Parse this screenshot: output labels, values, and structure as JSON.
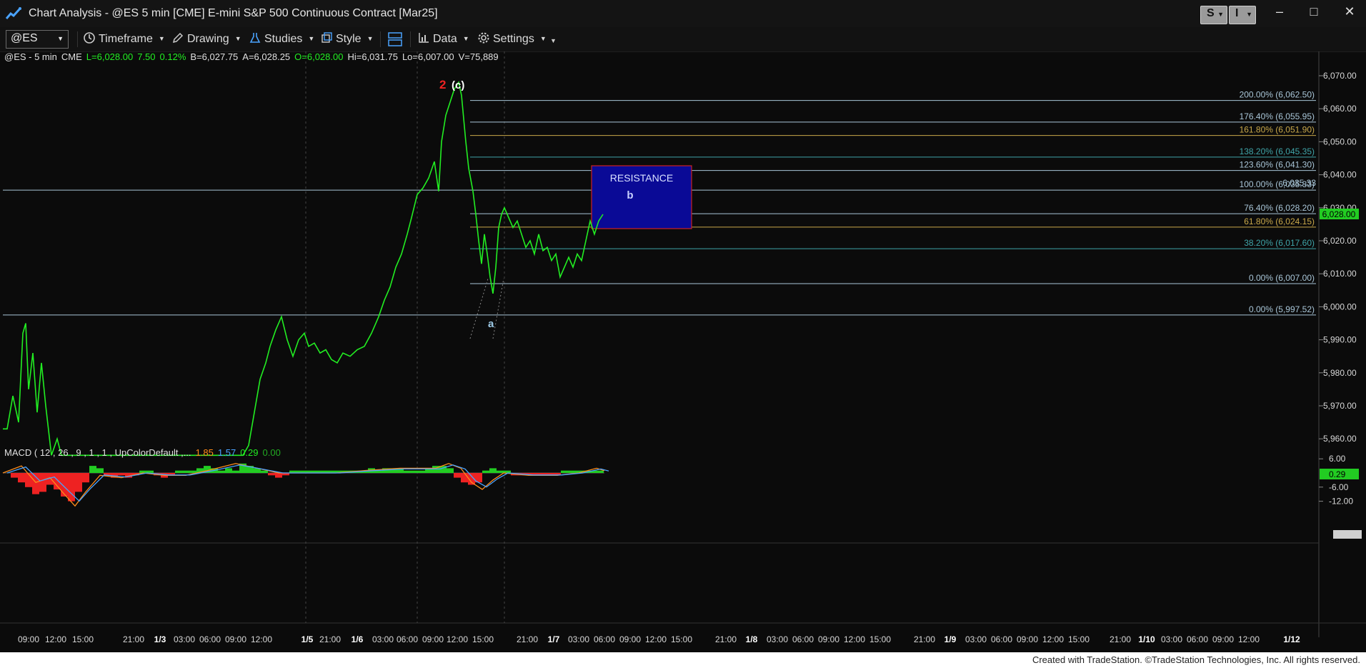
{
  "window": {
    "title": "Chart Analysis - @ES 5 min [CME] E-mini S&P 500 Continuous Contract [Mar25]",
    "buttons": [
      "S",
      "I"
    ],
    "controls": [
      "–",
      "□",
      "✕"
    ]
  },
  "toolbar": {
    "symbol": "@ES",
    "items": [
      {
        "label": "Timeframe",
        "icon": "clock-icon"
      },
      {
        "label": "Drawing",
        "icon": "pencil-icon"
      },
      {
        "label": "Studies",
        "icon": "flask-icon"
      },
      {
        "label": "Style",
        "icon": "style-icon"
      },
      {
        "label": "Data",
        "icon": "bar-chart-icon"
      },
      {
        "label": "Settings",
        "icon": "gear-icon"
      }
    ]
  },
  "status_line": {
    "symbol": "@ES - 5 min",
    "exchange": "CME",
    "last": "L=6,028.00",
    "change": "7.50",
    "pct": "0.12%",
    "bid": "B=6,027.75",
    "ask": "A=6,028.25",
    "open": "O=6,028.00",
    "high": "Hi=6,031.75",
    "low": "Lo=6,007.00",
    "volume": "V=75,889"
  },
  "macd_status": {
    "label": "MACD ( 12 , 26 , 9 , 1 , 1 , UpColorDefault ,...",
    "v1": "1.85",
    "v2": "1.57",
    "v3": "0.29",
    "v4": "0.00"
  },
  "price_axis": {
    "ticks": [
      "6,070.00",
      "6,060.00",
      "6,050.00",
      "6,040.00",
      "6,030.00",
      "6,020.00",
      "6,010.00",
      "6,000.00",
      "5,990.00",
      "5,980.00",
      "5,970.00",
      "5,960.00"
    ],
    "tick_values": [
      6070,
      6060,
      6050,
      6040,
      6030,
      6020,
      6010,
      6000,
      5990,
      5980,
      5970,
      5960
    ],
    "last_price": "6,028.00",
    "last_price_value": 6028
  },
  "macd_axis": {
    "ticks": [
      "6.00",
      "-6.00",
      "-12.00"
    ],
    "tick_values": [
      6,
      -6,
      -12
    ],
    "current": "0.29",
    "current_value": 0.29
  },
  "time_axis": [
    "09:00",
    "12:00",
    "15:00",
    "21:00",
    "1/3",
    "03:00",
    "06:00",
    "09:00",
    "12:00",
    "1/5",
    "21:00",
    "1/6",
    "03:00",
    "06:00",
    "09:00",
    "12:00",
    "15:00",
    "21:00",
    "1/7",
    "03:00",
    "06:00",
    "09:00",
    "12:00",
    "15:00",
    "21:00",
    "1/8",
    "03:00",
    "06:00",
    "09:00",
    "12:00",
    "15:00",
    "21:00",
    "1/9",
    "03:00",
    "06:00",
    "09:00",
    "12:00",
    "15:00",
    "21:00",
    "1/10",
    "03:00",
    "06:00",
    "09:00",
    "12:00",
    "1/12"
  ],
  "annotations": {
    "wave_2": "2",
    "wave_c": "(c)",
    "wave_a": "a",
    "wave_b": "b",
    "resistance": "RESISTANCE"
  },
  "fib_levels": [
    {
      "label": "200.00% (6,062.50)",
      "value": 6062.5,
      "color": "#a9c6d8"
    },
    {
      "label": "176.40% (6,055.95)",
      "value": 6055.95,
      "color": "#a9c6d8"
    },
    {
      "label": "161.80% (6,051.90)",
      "value": 6051.9,
      "color": "#c9a84a"
    },
    {
      "label": "138.20% (6,045.35)",
      "value": 6045.35,
      "color": "#3fa4a8"
    },
    {
      "label": "123.60% (6,041.30)",
      "value": 6041.3,
      "color": "#a9c6d8"
    },
    {
      "label": "100.00% (6,035.33)",
      "value": 6035.33,
      "color": "#a9c6d8"
    },
    {
      "label": "76.40% (6,028.20)",
      "value": 6028.2,
      "color": "#a9c6d8"
    },
    {
      "label": "61.80% (6,024.15)",
      "value": 6024.15,
      "color": "#c9a84a"
    },
    {
      "label": "38.20% (6,017.60)",
      "value": 6017.6,
      "color": "#3fa4a8"
    },
    {
      "label": "0.00% (6,007.00)",
      "value": 6007.0,
      "color": "#a9c6d8"
    },
    {
      "label": "0.00% (5,997.52)",
      "value": 5997.52,
      "color": "#a9c6d8"
    }
  ],
  "extra_labels": {
    "overlap": "6,035.33"
  },
  "colors": {
    "price": "#22ee22",
    "resistance_fill": "#0a0a96",
    "resistance_border": "#cc2222",
    "macd_up": "#22cc22",
    "macd_down": "#ee2222",
    "wave_red": "#ee2222"
  },
  "footer": "Created with TradeStation. ©TradeStation Technologies, Inc. All rights reserved."
}
